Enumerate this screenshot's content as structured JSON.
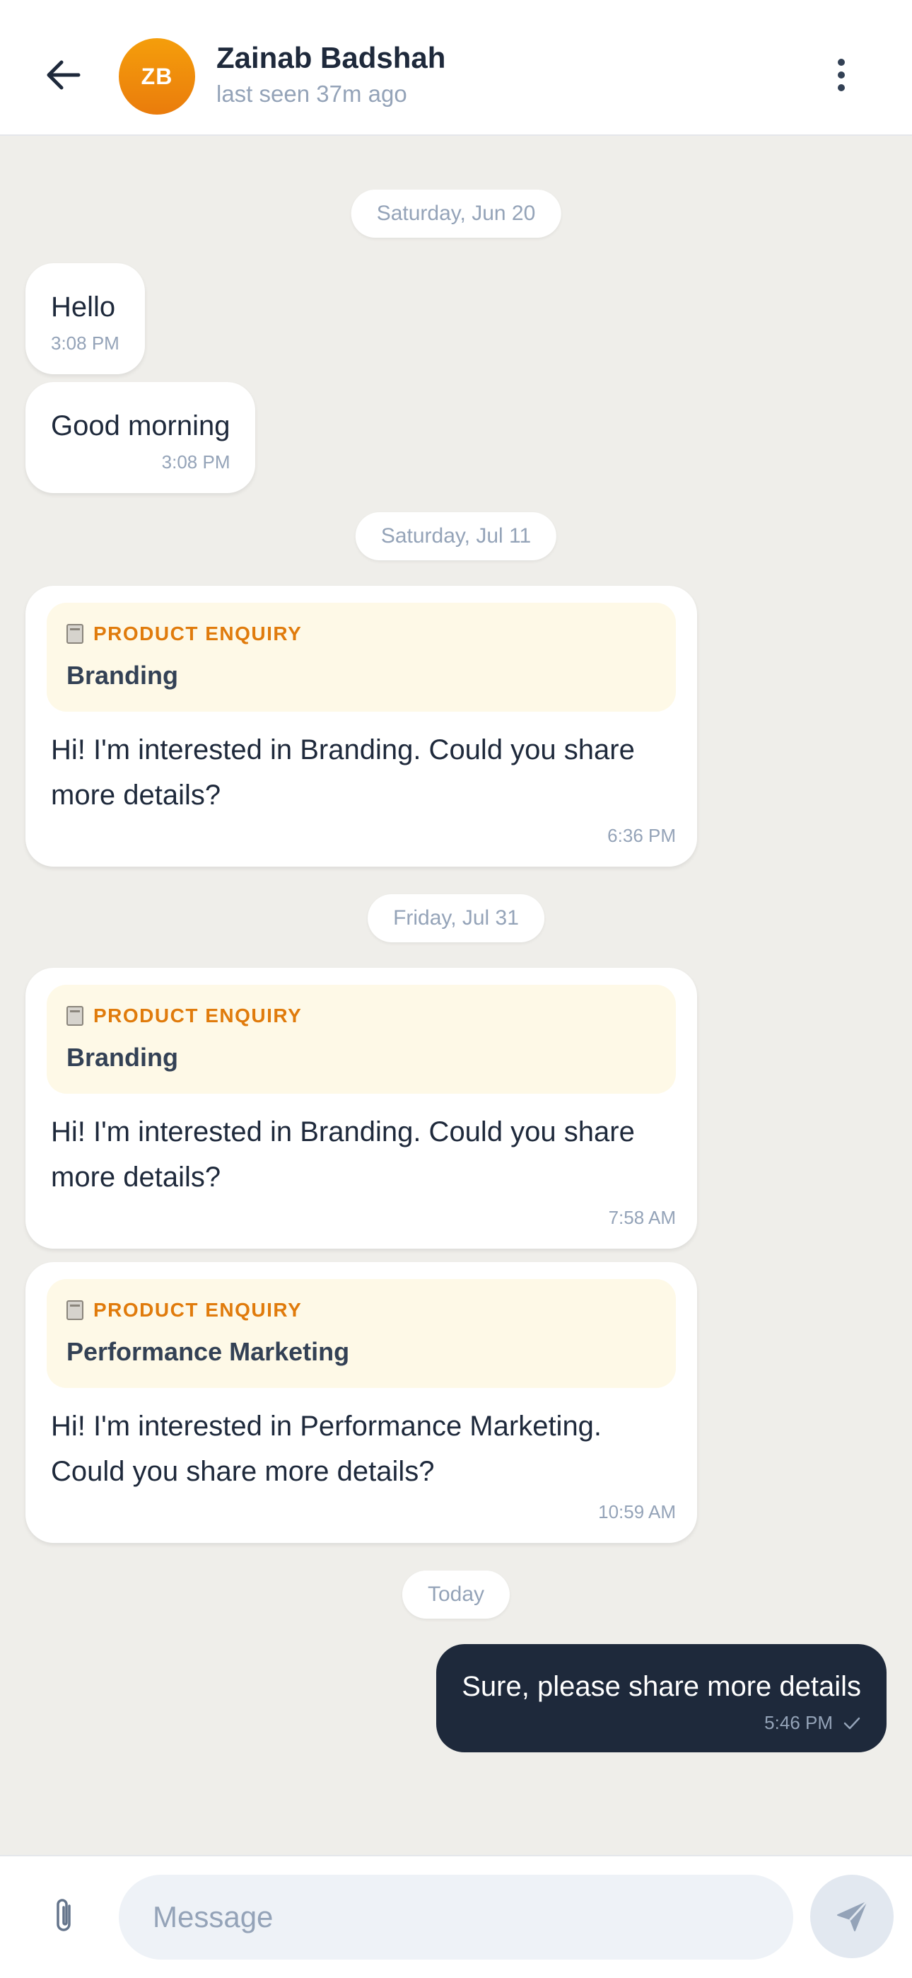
{
  "header": {
    "back_icon": "arrow-left-icon",
    "avatar_initials": "ZB",
    "contact_name": "Zainab Badshah",
    "status": "last seen 37m ago",
    "menu_icon": "more-vertical-icon"
  },
  "colors": {
    "accent_orange": "#ea7c0c",
    "outgoing_bubble": "#1e293b",
    "enquiry_bg": "#fef9e7",
    "chat_bg": "#efeeea"
  },
  "chat": {
    "date_1": "Saturday, Jun 20",
    "msg_1": {
      "text": "Hello",
      "time": "3:08 PM"
    },
    "msg_2": {
      "text": "Good morning",
      "time": "3:08 PM"
    },
    "date_2": "Saturday, Jul 11",
    "msg_3": {
      "tag": "PRODUCT ENQUIRY",
      "product": "Branding",
      "text": "Hi! I'm interested in Branding. Could you share more details?",
      "time": "6:36 PM"
    },
    "date_3": "Friday, Jul 31",
    "msg_4": {
      "tag": "PRODUCT ENQUIRY",
      "product": "Branding",
      "text": "Hi! I'm interested in Branding. Could you share more details?",
      "time": "7:58 AM"
    },
    "msg_5": {
      "tag": "PRODUCT ENQUIRY",
      "product": "Performance Marketing",
      "text": "Hi! I'm interested in Performance Marketing. Could you share more details?",
      "time": "10:59 AM"
    },
    "date_4": "Today",
    "msg_6": {
      "text": "Sure, please share more details",
      "time": "5:46 PM"
    }
  },
  "composer": {
    "attach_icon": "paperclip-icon",
    "placeholder": "Message",
    "send_icon": "send-icon"
  }
}
